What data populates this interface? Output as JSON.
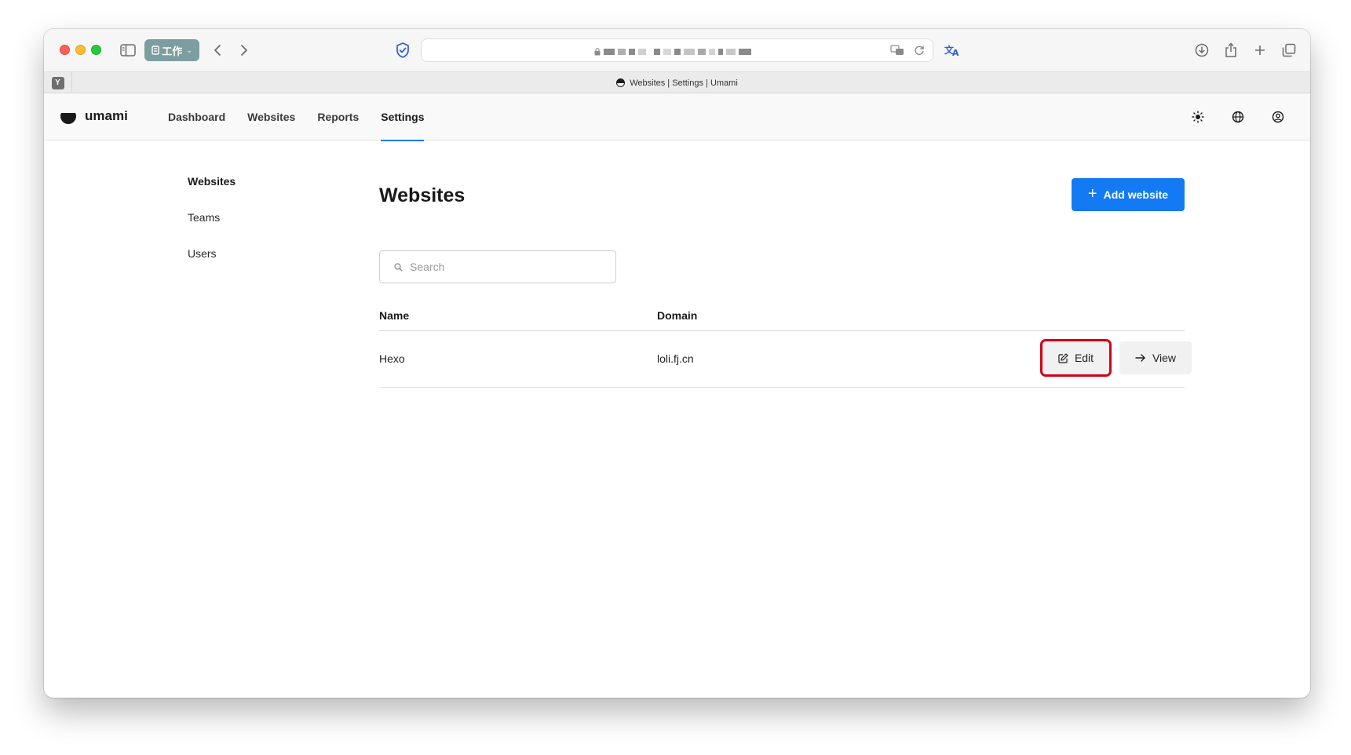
{
  "browser": {
    "tab_group_label": "工作",
    "tab_title": "Websites | Settings | Umami",
    "pinned_tab_letter": "Y"
  },
  "app": {
    "brand": "umami",
    "nav": [
      {
        "label": "Dashboard"
      },
      {
        "label": "Websites"
      },
      {
        "label": "Reports"
      },
      {
        "label": "Settings"
      }
    ]
  },
  "sidebar": {
    "items": [
      {
        "label": "Websites"
      },
      {
        "label": "Teams"
      },
      {
        "label": "Users"
      }
    ]
  },
  "main": {
    "title": "Websites",
    "add_button_label": "Add website",
    "search_placeholder": "Search",
    "table": {
      "columns": [
        "Name",
        "Domain"
      ],
      "rows": [
        {
          "name": "Hexo",
          "domain": "loli.fj.cn",
          "edit_label": "Edit",
          "view_label": "View"
        }
      ]
    }
  },
  "colors": {
    "accent": "#147af3",
    "highlight": "#d0021b"
  }
}
